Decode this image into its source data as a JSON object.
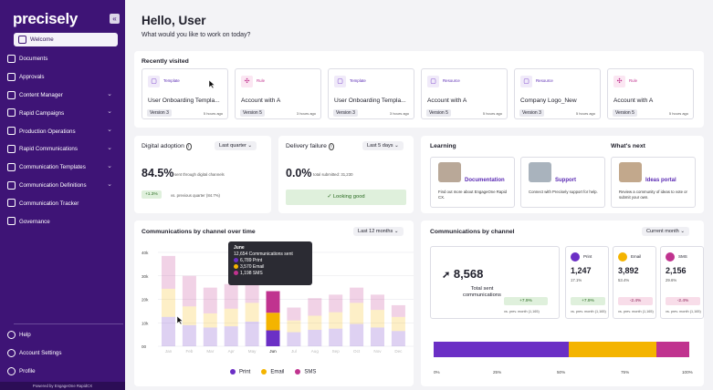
{
  "sidebar": {
    "logo": "precisely",
    "collapse_icon": "«",
    "items": [
      {
        "label": "Welcome",
        "icon": "home-icon",
        "active": true,
        "chevron": false
      },
      {
        "label": "Documents",
        "icon": "document-icon",
        "chevron": false
      },
      {
        "label": "Approvals",
        "icon": "checkbox-icon",
        "chevron": false
      },
      {
        "label": "Content Manager",
        "icon": "content-icon",
        "chevron": true
      },
      {
        "label": "Rapid Campaigns",
        "icon": "campaign-icon",
        "chevron": true
      },
      {
        "label": "Production Operations",
        "icon": "production-icon",
        "chevron": true
      },
      {
        "label": "Rapid Communications",
        "icon": "communications-icon",
        "chevron": true
      },
      {
        "label": "Communication Templates",
        "icon": "template-icon",
        "chevron": true
      },
      {
        "label": "Communication Definitions",
        "icon": "code-icon",
        "chevron": true
      },
      {
        "label": "Communication Tracker",
        "icon": "tracker-icon",
        "chevron": false
      },
      {
        "label": "Governance",
        "icon": "governance-icon",
        "chevron": false
      }
    ],
    "bottom_items": [
      {
        "label": "Help",
        "icon": "help-icon"
      },
      {
        "label": "Account Settings",
        "icon": "settings-icon"
      },
      {
        "label": "Profile",
        "icon": "profile-icon"
      }
    ],
    "powered_by": "Powered by EngageOne RapidCX"
  },
  "header": {
    "greeting": "Hello, User",
    "subtitle": "What would you like to work on today?"
  },
  "recently_visited": {
    "title": "Recently visited",
    "items": [
      {
        "type": "Template",
        "icon": "template-icon",
        "name": "User Onboarding Templa...",
        "version": "Version 3",
        "ago": "5 hours ago"
      },
      {
        "type": "Rule",
        "icon": "rule-icon",
        "name": "Account with A",
        "version": "Version 5",
        "ago": "3 hours ago"
      },
      {
        "type": "Template",
        "icon": "template-icon",
        "name": "User Onboarding Templa...",
        "version": "Version 3",
        "ago": "3 hours ago"
      },
      {
        "type": "Resource",
        "icon": "resource-icon",
        "name": "Account with A",
        "version": "Version 5",
        "ago": "5 hours ago"
      },
      {
        "type": "Resource",
        "icon": "resource-icon",
        "name": "Company Logo_New",
        "version": "Version 3",
        "ago": "5 hours ago"
      },
      {
        "type": "Rule",
        "icon": "rule-icon",
        "name": "Account with A",
        "version": "Version 5",
        "ago": "5 hours ago"
      }
    ]
  },
  "digital_adoption": {
    "title": "Digital adoption",
    "info_icon": "info-icon",
    "period": "Last quarter",
    "value": "84.5%",
    "caption": "sent through digital channels",
    "change": "+1.3%",
    "change_caption": "vs. previous quarter (84.7%)"
  },
  "delivery_failure": {
    "title": "Delivery failure",
    "info_icon": "info-icon",
    "period": "Last 5 days",
    "value": "0.0%",
    "caption": "total submitted: 31,230",
    "status": "Looking good"
  },
  "learning": {
    "title": "Learning",
    "items": [
      {
        "title": "Documentation",
        "desc": "Find out more about EngageOne Rapid CX."
      },
      {
        "title": "Support",
        "desc": "Connect with Precisely support for help."
      }
    ]
  },
  "whats_next": {
    "title": "What's next",
    "items": [
      {
        "title": "Ideas portal",
        "desc": "Review a community of ideas to vote or submit your own."
      }
    ]
  },
  "comm_over_time": {
    "title": "Communications by channel over time",
    "period": "Last 12 months",
    "tooltip": {
      "month": "June",
      "total": "12,654 Communications sent",
      "print": "6,789 Print",
      "email": "3,570 Email",
      "sms": "1,198 SMS"
    }
  },
  "comm_by_channel": {
    "title": "Communications by channel",
    "period": "Current month",
    "total": "8,568",
    "total_label": "Total sent communications",
    "total_change": "+7.9%",
    "total_prev": "vs. prev. month (1,165)",
    "channels": [
      {
        "label": "Print",
        "value": "1,247",
        "pct": "17.1%",
        "change": "+7.9%",
        "prev": "vs. prev. month (1,165)",
        "color": "#6b2fc5",
        "positive": true
      },
      {
        "label": "Email",
        "value": "3,892",
        "pct": "53.4%",
        "change": "-2.4%",
        "prev": "vs. prev. month (1,165)",
        "color": "#f4b400",
        "positive": false
      },
      {
        "label": "SMS",
        "value": "2,156",
        "pct": "29.6%",
        "change": "-2.4%",
        "prev": "vs. prev. month (1,165)",
        "color": "#c0338f",
        "positive": false
      }
    ],
    "axis_ticks": [
      "0%",
      "25%",
      "50%",
      "75%",
      "100%"
    ]
  },
  "chart_data": [
    {
      "type": "bar",
      "stacked": true,
      "categories": [
        "Jan",
        "Feb",
        "Mar",
        "Apr",
        "May",
        "Jun",
        "Jul",
        "Aug",
        "Sep",
        "Oct",
        "Nov",
        "Dec"
      ],
      "highlighted": "Jun",
      "series": [
        {
          "name": "Print",
          "color": "#6b2fc5",
          "values": [
            12500,
            9000,
            8000,
            8500,
            10500,
            6789,
            6000,
            7000,
            7500,
            9500,
            8000,
            6500
          ]
        },
        {
          "name": "Email",
          "color": "#f4b400",
          "values": [
            12000,
            8000,
            6000,
            7500,
            8000,
            7500,
            5000,
            6000,
            7000,
            9000,
            7500,
            6000
          ]
        },
        {
          "name": "SMS",
          "color": "#c0338f",
          "values": [
            14000,
            13000,
            11000,
            10500,
            12000,
            9200,
            5500,
            7500,
            7500,
            6500,
            6500,
            5000
          ]
        }
      ],
      "yticks": [
        "00",
        "10k",
        "20k",
        "30k",
        "40k"
      ],
      "ylim": [
        0,
        40000
      ]
    },
    {
      "type": "bar",
      "stacked": true,
      "orientation": "horizontal",
      "series": [
        {
          "name": "Print",
          "color": "#6b2fc5",
          "values": [
            53
          ]
        },
        {
          "name": "Email",
          "color": "#f4b400",
          "values": [
            34
          ]
        },
        {
          "name": "SMS",
          "color": "#c0338f",
          "values": [
            13
          ]
        }
      ],
      "xticks": [
        "0%",
        "25%",
        "50%",
        "75%",
        "100%"
      ],
      "xlim": [
        0,
        100
      ]
    }
  ]
}
